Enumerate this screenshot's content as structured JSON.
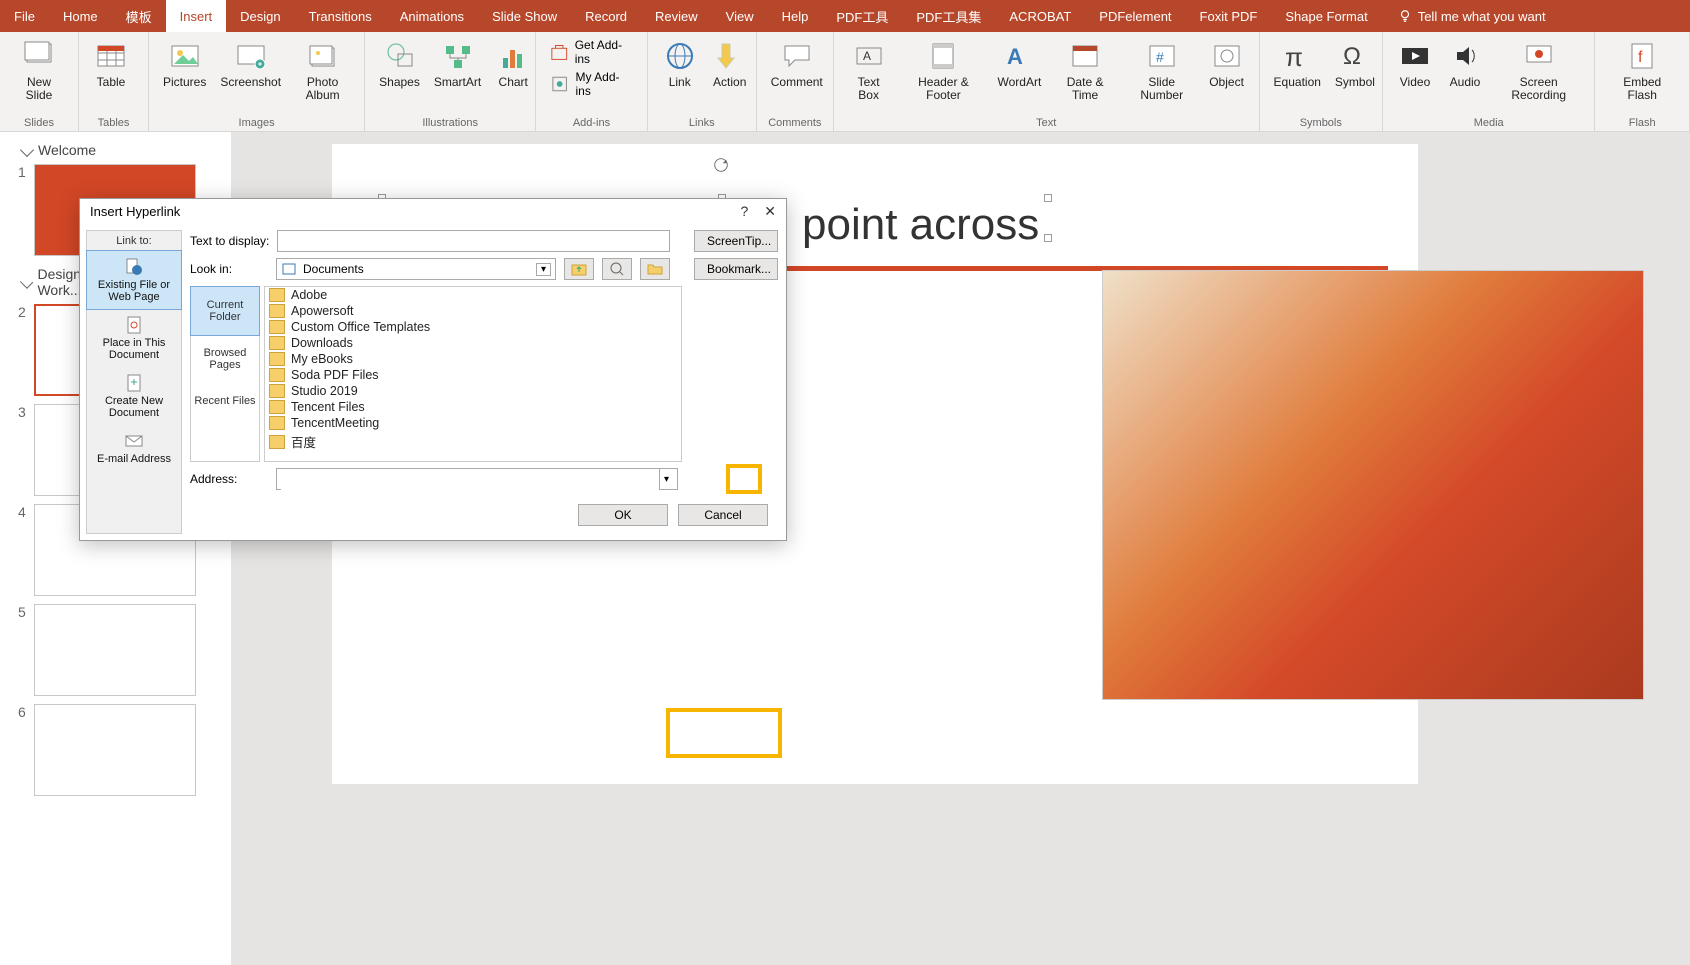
{
  "tabs": {
    "file": "File",
    "home": "Home",
    "templates": "模板",
    "insert": "Insert",
    "design": "Design",
    "transitions": "Transitions",
    "animations": "Animations",
    "slideshow": "Slide Show",
    "record": "Record",
    "review": "Review",
    "view": "View",
    "help": "Help",
    "pdftool": "PDF工具",
    "pdftoolset": "PDF工具集",
    "acrobat": "ACROBAT",
    "pdfelement": "PDFelement",
    "foxit": "Foxit PDF",
    "shapefmt": "Shape Format",
    "tell": "Tell me what you want"
  },
  "ribbon": {
    "slides": {
      "name": "Slides",
      "newslide": "New\nSlide"
    },
    "tables": {
      "name": "Tables",
      "table": "Table"
    },
    "images": {
      "name": "Images",
      "pictures": "Pictures",
      "screenshot": "Screenshot",
      "photoalbum": "Photo\nAlbum"
    },
    "illustrations": {
      "name": "Illustrations",
      "shapes": "Shapes",
      "smartart": "SmartArt",
      "chart": "Chart"
    },
    "addins": {
      "name": "Add-ins",
      "get": "Get Add-ins",
      "my": "My Add-ins"
    },
    "links": {
      "name": "Links",
      "link": "Link",
      "action": "Action"
    },
    "comments": {
      "name": "Comments",
      "comment": "Comment"
    },
    "text": {
      "name": "Text",
      "textbox": "Text\nBox",
      "header": "Header\n& Footer",
      "wordart": "WordArt",
      "datetime": "Date &\nTime",
      "slidenumber": "Slide\nNumber",
      "object": "Object"
    },
    "symbols": {
      "name": "Symbols",
      "equation": "Equation",
      "symbol": "Symbol"
    },
    "media": {
      "name": "Media",
      "video": "Video",
      "audio": "Audio",
      "screenrec": "Screen\nRecording"
    },
    "flash": {
      "name": "Flash",
      "embed": "Embed\nFlash"
    }
  },
  "side": {
    "sec1": "Welcome",
    "sec2": "Design, Morph, Annotate, Work..."
  },
  "slide": {
    "title_fragment": "point across"
  },
  "dialog": {
    "title": "Insert Hyperlink",
    "help": "?",
    "close": "✕",
    "linkto_label": "Link to:",
    "linkto": {
      "existing": "Existing File or Web Page",
      "place": "Place in This Document",
      "createnew": "Create New Document",
      "email": "E-mail Address"
    },
    "text_to_display": "Text to display:",
    "screentip": "ScreenTip...",
    "lookin": "Look in:",
    "lookin_value": "Documents",
    "bookmark": "Bookmark...",
    "tabs": {
      "current": "Current Folder",
      "browsed": "Browsed Pages",
      "recent": "Recent Files"
    },
    "files": [
      "Adobe",
      "Apowersoft",
      "Custom Office Templates",
      "Downloads",
      "My eBooks",
      "Soda PDF Files",
      "Studio 2019",
      "Tencent Files",
      "TencentMeeting",
      "百度"
    ],
    "address": "Address:",
    "ok": "OK",
    "cancel": "Cancel"
  }
}
